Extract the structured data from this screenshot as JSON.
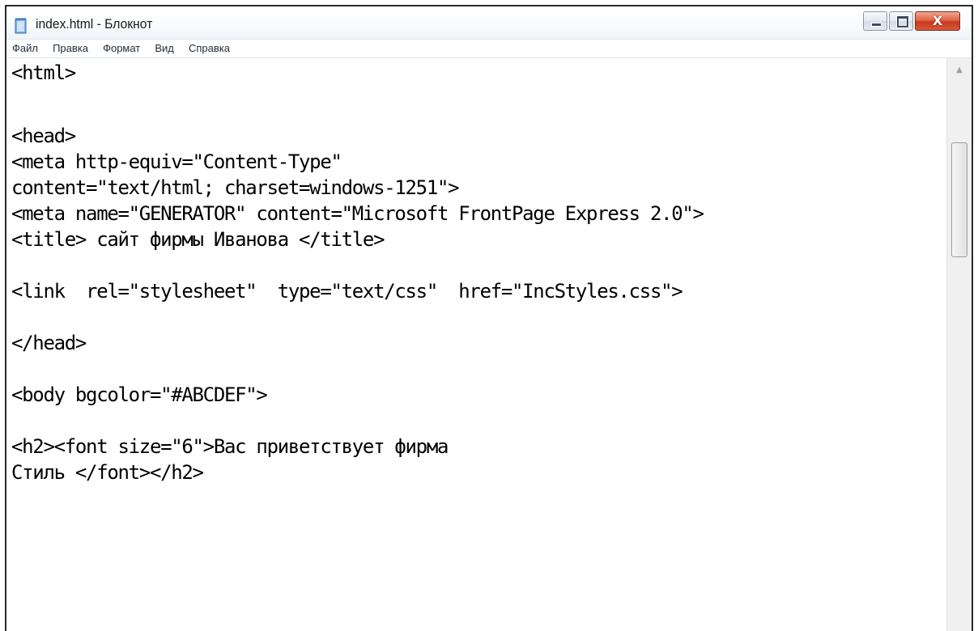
{
  "window": {
    "title": "index.html - Блокнот",
    "buttons": {
      "minimize_icon": "minimize-icon",
      "maximize_icon": "maximize-icon",
      "close_glyph": "X"
    },
    "close_color": "#c7391c"
  },
  "menu": {
    "items": [
      {
        "label": "Файл"
      },
      {
        "label": "Правка"
      },
      {
        "label": "Формат"
      },
      {
        "label": "Вид"
      },
      {
        "label": "Справка"
      }
    ]
  },
  "editor": {
    "lines": [
      "<html>",
      "",
      "<head>",
      "<meta http-equiv=\"Content-Type\"",
      "content=\"text/html; charset=windows-1251\">",
      "<meta name=\"GENERATOR\" content=\"Microsoft FrontPage Express 2.0\">",
      "<title> сайт фирмы Иванова </title>",
      "",
      "<link  rel=\"stylesheet\"  type=\"text/css\"  href=\"IncStyles.css\">",
      "",
      "</head>",
      "",
      "<body bgcolor=\"#ABCDEF\">",
      "",
      "<h2><font size=\"6\">Вас приветствует фирма",
      "Стиль </font></h2>"
    ]
  },
  "icons": {
    "app": "notepad-icon",
    "scroll_up": "scroll-up-arrow-icon"
  }
}
